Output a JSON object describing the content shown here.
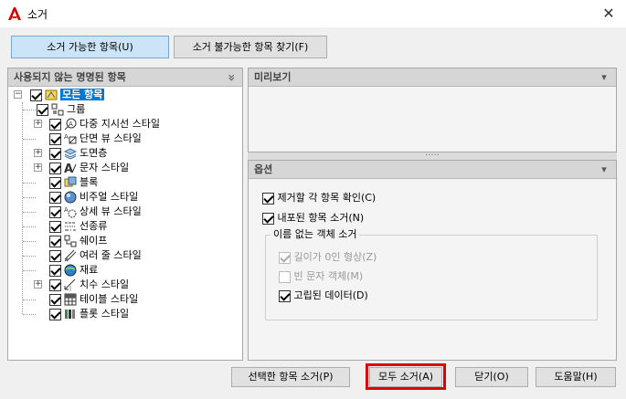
{
  "window": {
    "title": "소거",
    "close": "✕"
  },
  "tabs": [
    {
      "label": "소거 가능한 항목(U)"
    },
    {
      "label": "소거 불가능한 항목 찾기(F)"
    }
  ],
  "tree": {
    "header": "사용되지 않는 명명된 항목",
    "collapse_icon": "»",
    "root": "모든 항목",
    "items": [
      {
        "label": "그룹",
        "icon": "group-icon",
        "expandable": false
      },
      {
        "label": "다중 지시선 스타일",
        "icon": "mleader-icon",
        "expandable": true
      },
      {
        "label": "단면 뷰 스타일",
        "icon": "section-view-icon",
        "expandable": false
      },
      {
        "label": "도면층",
        "icon": "layers-icon",
        "expandable": true
      },
      {
        "label": "문자 스타일",
        "icon": "text-style-icon",
        "expandable": true
      },
      {
        "label": "블록",
        "icon": "block-icon",
        "expandable": false
      },
      {
        "label": "비주얼 스타일",
        "icon": "visual-style-icon",
        "expandable": false
      },
      {
        "label": "상세 뷰 스타일",
        "icon": "detail-view-icon",
        "expandable": false
      },
      {
        "label": "선종류",
        "icon": "linetype-icon",
        "expandable": false
      },
      {
        "label": "쉐이프",
        "icon": "shape-icon",
        "expandable": false
      },
      {
        "label": "여러 줄 스타일",
        "icon": "mline-icon",
        "expandable": false
      },
      {
        "label": "재료",
        "icon": "material-icon",
        "expandable": false
      },
      {
        "label": "치수 스타일",
        "icon": "dim-style-icon",
        "expandable": true
      },
      {
        "label": "테이블 스타일",
        "icon": "table-style-icon",
        "expandable": false
      },
      {
        "label": "플롯 스타일",
        "icon": "plot-style-icon",
        "expandable": false
      }
    ]
  },
  "preview": {
    "header": "미리보기",
    "arrow": "▾",
    "splitter": "....."
  },
  "options": {
    "header": "옵션",
    "arrow": "▾",
    "confirm_each": "제거할 각 항목 확인(C)",
    "purge_nested": "내포된 항목 소거(N)",
    "group_title": "이름 없는 객체 소거",
    "zero_length": "길이가 0인 형상(Z)",
    "empty_text": "빈 문자 객체(M)",
    "orphaned": "고립된 데이터(D)"
  },
  "buttons": {
    "purge_checked": "선택한 항목 소거(P)",
    "purge_all": "모두 소거(A)",
    "close": "닫기(O)",
    "help": "도움말(H)"
  },
  "colors": {
    "highlight": "#e00000",
    "selection": "#0078d7",
    "app_red": "#d40000"
  }
}
